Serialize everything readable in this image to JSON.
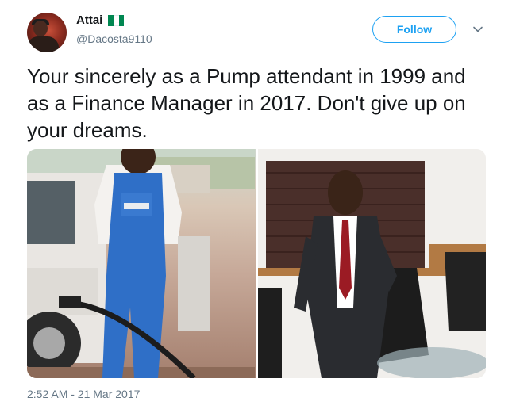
{
  "author": {
    "display_name": "Attai",
    "handle": "@Dacosta9110",
    "flag_icon": "nigeria-flag-icon",
    "flag_colors": [
      "#008751",
      "#ffffff",
      "#008751"
    ]
  },
  "follow_button": {
    "label": "Follow",
    "color": "#1da1f2"
  },
  "menu": {
    "icon": "chevron-down-icon"
  },
  "tweet": {
    "text": "Your sincerely as a Pump attendant in 1999 and as a Finance Manager in 2017. Don't give up on your dreams."
  },
  "media": [
    {
      "name": "photo-pump-attendant"
    },
    {
      "name": "photo-finance-manager"
    }
  ],
  "timestamp": "2:52 AM - 21 Mar 2017"
}
